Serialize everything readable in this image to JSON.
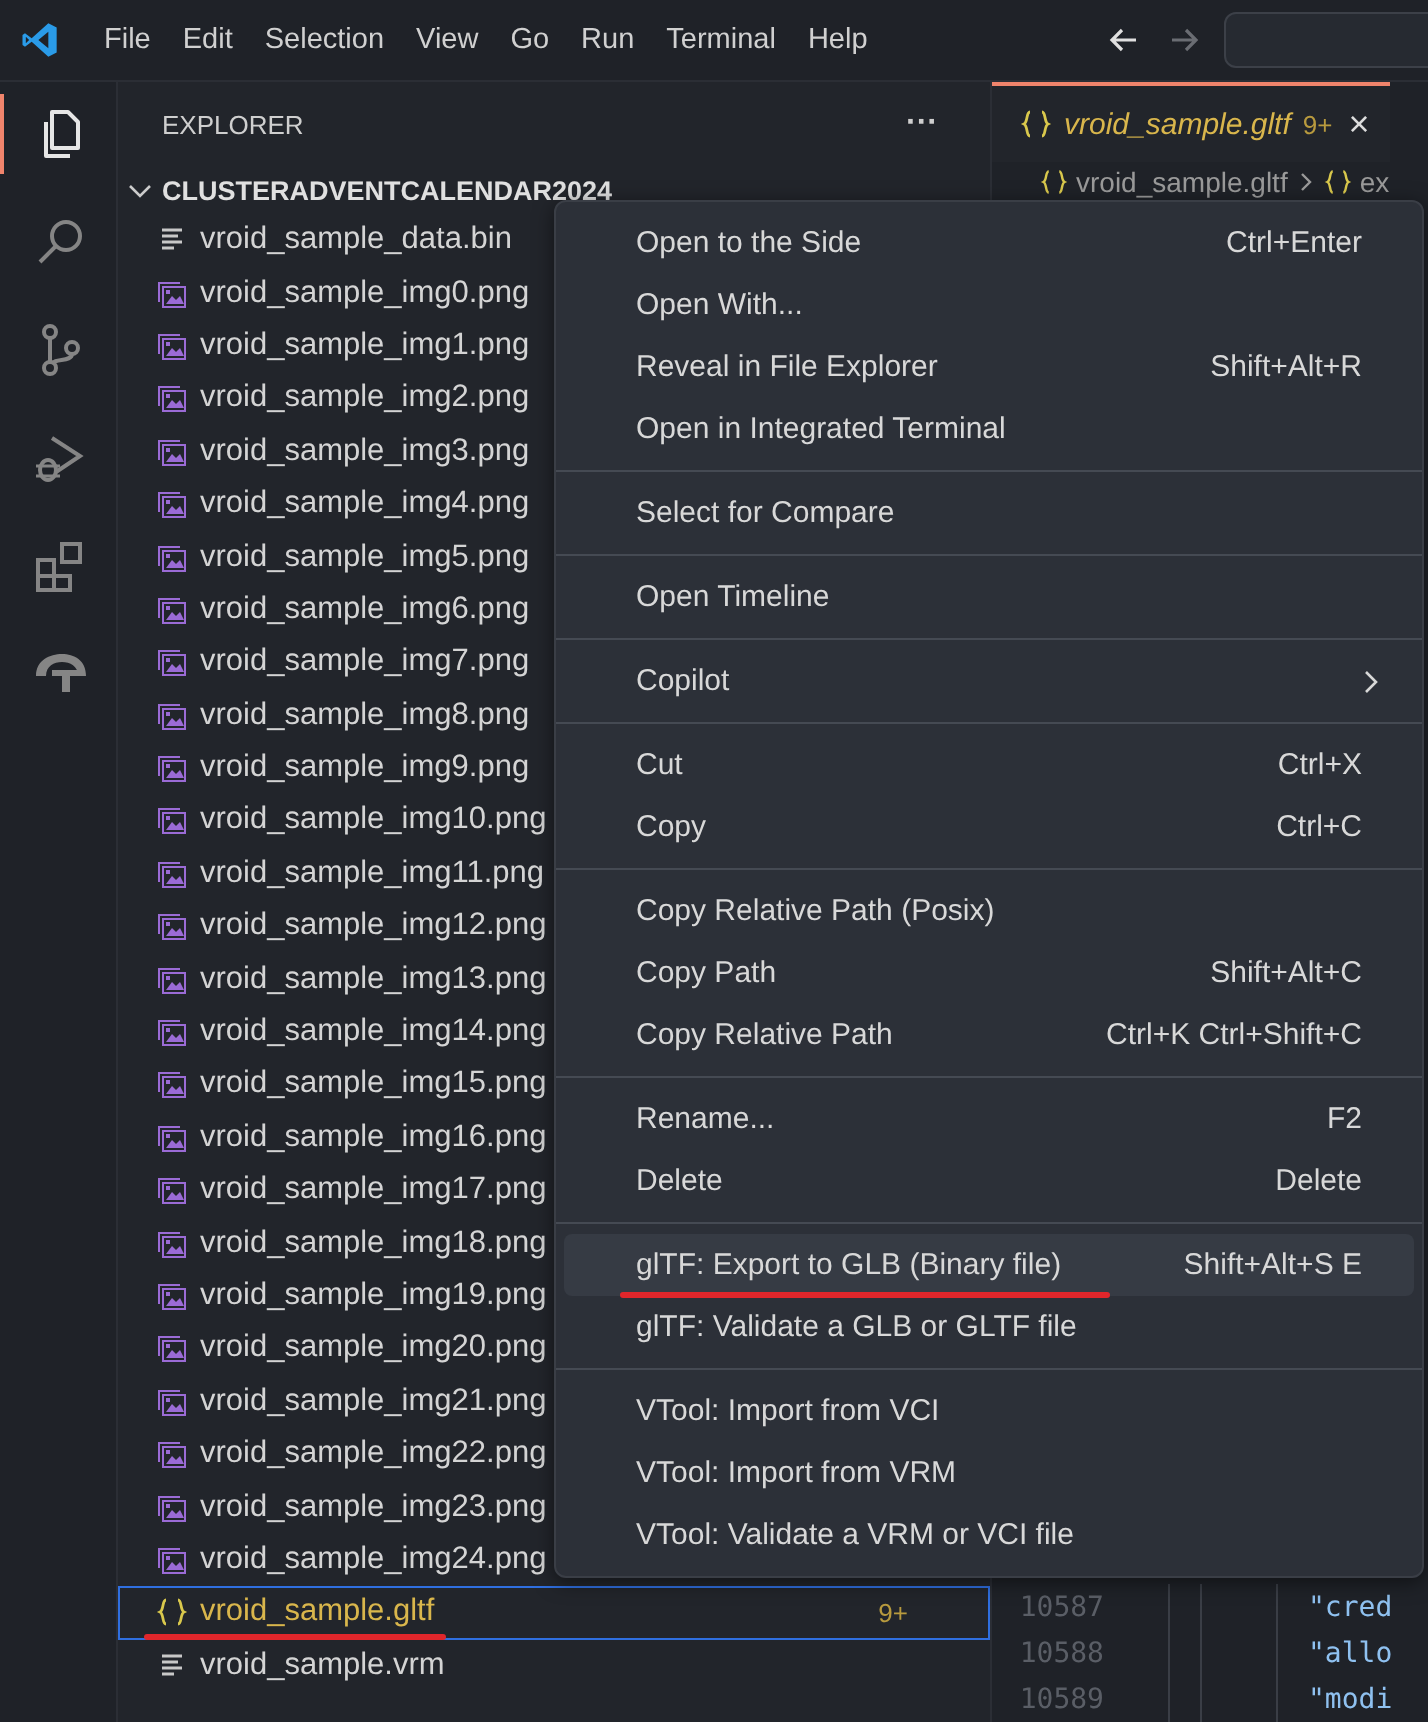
{
  "menu_bar": [
    "File",
    "Edit",
    "Selection",
    "View",
    "Go",
    "Run",
    "Terminal",
    "Help"
  ],
  "activity_bar": [
    {
      "kind": "explorer",
      "selected": true
    },
    {
      "kind": "search",
      "selected": false
    },
    {
      "kind": "source-control",
      "selected": false
    },
    {
      "kind": "debug",
      "selected": false
    },
    {
      "kind": "extensions",
      "selected": false
    },
    {
      "kind": "tf",
      "selected": false
    }
  ],
  "sidebar": {
    "title": "EXPLORER",
    "more": "···",
    "folder": {
      "name": "CLUSTERADVENTCALENDAR2024",
      "expanded": true,
      "children": [
        {
          "name": "vroid_sample_data.bin",
          "kind": "binary",
          "selected": false
        },
        {
          "name": "vroid_sample_img0.png",
          "kind": "image",
          "selected": false
        },
        {
          "name": "vroid_sample_img1.png",
          "kind": "image",
          "selected": false
        },
        {
          "name": "vroid_sample_img2.png",
          "kind": "image",
          "selected": false
        },
        {
          "name": "vroid_sample_img3.png",
          "kind": "image",
          "selected": false
        },
        {
          "name": "vroid_sample_img4.png",
          "kind": "image",
          "selected": false
        },
        {
          "name": "vroid_sample_img5.png",
          "kind": "image",
          "selected": false
        },
        {
          "name": "vroid_sample_img6.png",
          "kind": "image",
          "selected": false
        },
        {
          "name": "vroid_sample_img7.png",
          "kind": "image",
          "selected": false
        },
        {
          "name": "vroid_sample_img8.png",
          "kind": "image",
          "selected": false
        },
        {
          "name": "vroid_sample_img9.png",
          "kind": "image",
          "selected": false
        },
        {
          "name": "vroid_sample_img10.png",
          "kind": "image",
          "selected": false
        },
        {
          "name": "vroid_sample_img11.png",
          "kind": "image",
          "selected": false
        },
        {
          "name": "vroid_sample_img12.png",
          "kind": "image",
          "selected": false
        },
        {
          "name": "vroid_sample_img13.png",
          "kind": "image",
          "selected": false
        },
        {
          "name": "vroid_sample_img14.png",
          "kind": "image",
          "selected": false
        },
        {
          "name": "vroid_sample_img15.png",
          "kind": "image",
          "selected": false
        },
        {
          "name": "vroid_sample_img16.png",
          "kind": "image",
          "selected": false
        },
        {
          "name": "vroid_sample_img17.png",
          "kind": "image",
          "selected": false
        },
        {
          "name": "vroid_sample_img18.png",
          "kind": "image",
          "selected": false
        },
        {
          "name": "vroid_sample_img19.png",
          "kind": "image",
          "selected": false
        },
        {
          "name": "vroid_sample_img20.png",
          "kind": "image",
          "selected": false
        },
        {
          "name": "vroid_sample_img21.png",
          "kind": "image",
          "selected": false
        },
        {
          "name": "vroid_sample_img22.png",
          "kind": "image",
          "selected": false
        },
        {
          "name": "vroid_sample_img23.png",
          "kind": "image",
          "selected": false
        },
        {
          "name": "vroid_sample_img24.png",
          "kind": "image",
          "selected": false
        },
        {
          "name": "vroid_sample.gltf",
          "kind": "json",
          "selected": true,
          "badge": "9+",
          "underlined": true
        },
        {
          "name": "vroid_sample.vrm",
          "kind": "binary",
          "selected": false
        }
      ]
    }
  },
  "editor": {
    "tab": {
      "title": "vroid_sample.gltf",
      "badge": "9+",
      "close": "×"
    },
    "breadcrumb": [
      "vroid_sample.gltf",
      "ex"
    ],
    "lines": [
      {
        "number": "10587",
        "code": "\"cred"
      },
      {
        "number": "10588",
        "code": "\"allo"
      },
      {
        "number": "10589",
        "code": "\"modi"
      }
    ]
  },
  "context_menu": [
    [
      {
        "label": "Open to the Side",
        "shortcut": "Ctrl+Enter"
      },
      {
        "label": "Open With..."
      },
      {
        "label": "Reveal in File Explorer",
        "shortcut": "Shift+Alt+R"
      },
      {
        "label": "Open in Integrated Terminal"
      }
    ],
    [
      {
        "label": "Select for Compare"
      }
    ],
    [
      {
        "label": "Open Timeline"
      }
    ],
    [
      {
        "label": "Copilot",
        "submenu": true
      }
    ],
    [
      {
        "label": "Cut",
        "shortcut": "Ctrl+X"
      },
      {
        "label": "Copy",
        "shortcut": "Ctrl+C"
      }
    ],
    [
      {
        "label": "Copy Relative Path (Posix)"
      },
      {
        "label": "Copy Path",
        "shortcut": "Shift+Alt+C"
      },
      {
        "label": "Copy Relative Path",
        "shortcut": "Ctrl+K Ctrl+Shift+C"
      }
    ],
    [
      {
        "label": "Rename...",
        "shortcut": "F2"
      },
      {
        "label": "Delete",
        "shortcut": "Delete"
      }
    ],
    [
      {
        "label": "glTF: Export to GLB (Binary file)",
        "shortcut": "Shift+Alt+S E",
        "highlighted": true,
        "underlined": true
      },
      {
        "label": "glTF: Validate a GLB or GLTF file"
      }
    ],
    [
      {
        "label": "VTool: Import from VCI"
      },
      {
        "label": "VTool: Import from VRM"
      },
      {
        "label": "VTool: Validate a VRM or VCI file"
      }
    ]
  ]
}
